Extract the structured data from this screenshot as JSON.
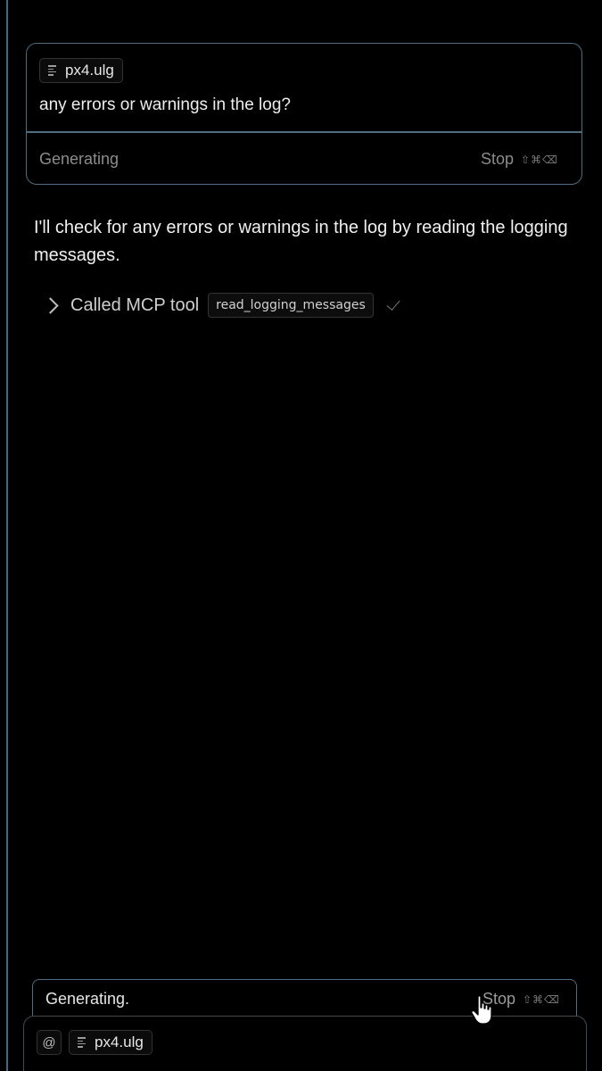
{
  "message": {
    "attachment": "px4.ulg",
    "text": "any errors or warnings in the log?",
    "status": "Generating",
    "stop_label": "Stop",
    "stop_shortcut": "⇧⌘⌫"
  },
  "assistant": {
    "text": "I'll check for any errors or warnings in the log by reading the logging messages.",
    "tool_call": {
      "label": "Called MCP tool",
      "tool_name": "read_logging_messages",
      "status_icon": "check-icon"
    }
  },
  "bottom_bar": {
    "status": "Generating.",
    "stop_label": "Stop",
    "stop_shortcut": "⇧⌘⌫"
  },
  "composer": {
    "mention_symbol": "@",
    "attachment": "px4.ulg"
  },
  "colors": {
    "background": "#000000",
    "accent_border": "#4f6e82",
    "muted_text": "#8c8c8c"
  }
}
